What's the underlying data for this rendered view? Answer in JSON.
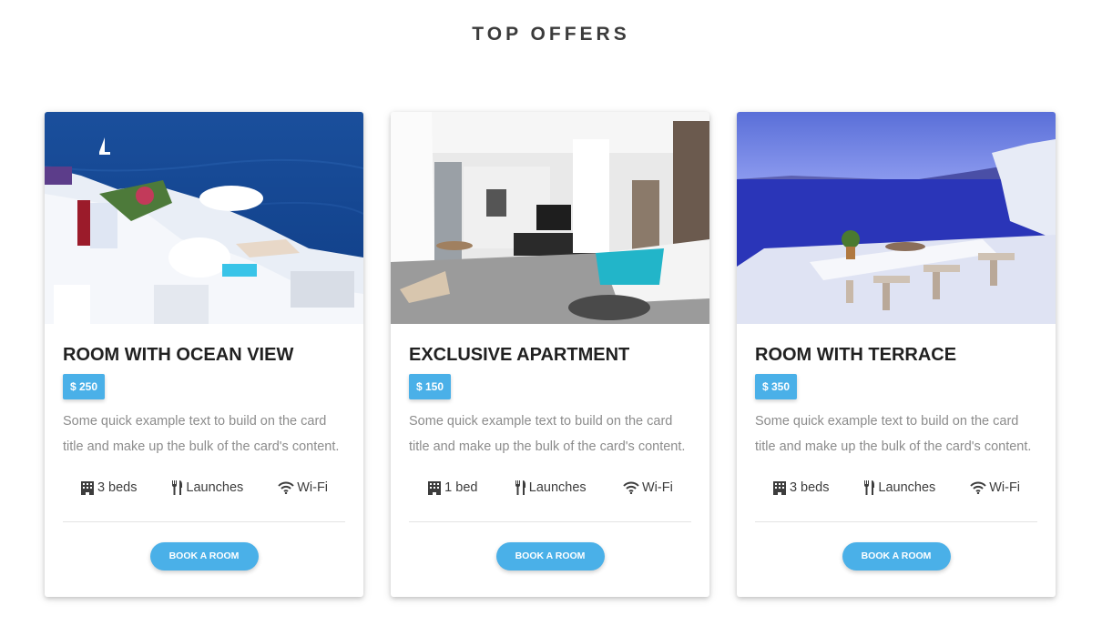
{
  "section": {
    "title": "TOP OFFERS"
  },
  "colors": {
    "accent": "#4ab0e8",
    "title": "#212121",
    "muted": "#8c8c8c"
  },
  "cards": [
    {
      "image": "santorini-ocean-view-photo",
      "title": "ROOM WITH OCEAN VIEW",
      "price": "$ 250",
      "text": "Some quick example text to build on the card title and make up the bulk of the card's content.",
      "amenities": [
        {
          "icon": "building-icon",
          "label": "3 beds"
        },
        {
          "icon": "utensils-icon",
          "label": "Launches"
        },
        {
          "icon": "wifi-icon",
          "label": "Wi-Fi"
        }
      ],
      "button": "BOOK A ROOM"
    },
    {
      "image": "apartment-interior-photo",
      "title": "EXCLUSIVE APARTMENT",
      "price": "$ 150",
      "text": "Some quick example text to build on the card title and make up the bulk of the card's content.",
      "amenities": [
        {
          "icon": "building-icon",
          "label": "1 bed"
        },
        {
          "icon": "utensils-icon",
          "label": "Launches"
        },
        {
          "icon": "wifi-icon",
          "label": "Wi-Fi"
        }
      ],
      "button": "BOOK A ROOM"
    },
    {
      "image": "terrace-sea-view-photo",
      "title": "ROOM WITH TERRACE",
      "price": "$ 350",
      "text": "Some quick example text to build on the card title and make up the bulk of the card's content.",
      "amenities": [
        {
          "icon": "building-icon",
          "label": "3 beds"
        },
        {
          "icon": "utensils-icon",
          "label": "Launches"
        },
        {
          "icon": "wifi-icon",
          "label": "Wi-Fi"
        }
      ],
      "button": "BOOK A ROOM"
    }
  ]
}
